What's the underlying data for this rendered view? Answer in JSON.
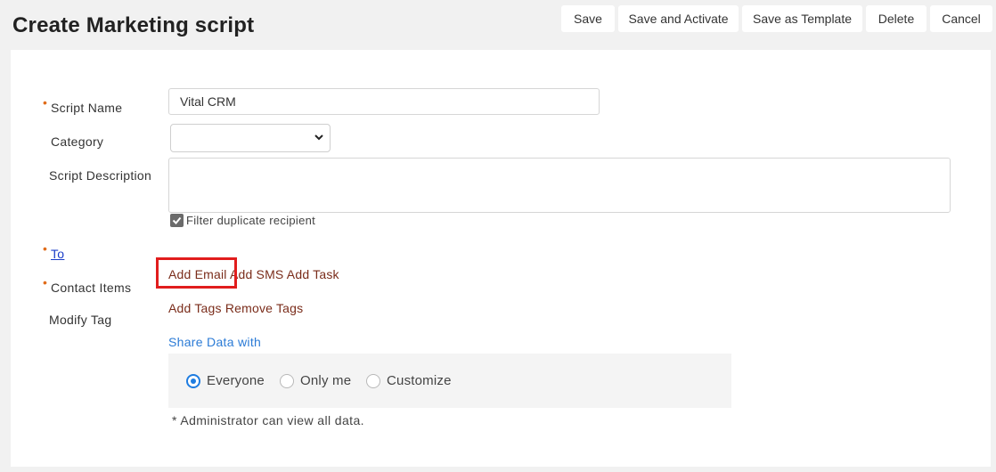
{
  "header": {
    "title": "Create Marketing script"
  },
  "toolbar": {
    "save": "Save",
    "save_activate": "Save and Activate",
    "save_template": "Save as Template",
    "delete": "Delete",
    "cancel": "Cancel"
  },
  "form": {
    "script_name_label": "Script Name",
    "script_name_value": "Vital CRM",
    "category_label": "Category",
    "category_value": "",
    "description_label": "Script Description",
    "description_value": "",
    "filter_duplicate_label": "Filter duplicate recipient",
    "filter_duplicate_checked": true,
    "to_label": "To",
    "contact_items_label": "Contact Items",
    "add_email": "Add Email",
    "add_sms": "Add SMS",
    "add_task": "Add Task",
    "modify_tag_label": "Modify Tag",
    "add_tags": "Add Tags",
    "remove_tags": "Remove Tags"
  },
  "share": {
    "link": "Share Data with",
    "options": [
      "Everyone",
      "Only me",
      "Customize"
    ],
    "selected": "Everyone",
    "note": "*  Administrator can view all data."
  },
  "colors": {
    "required_marker": "#e06c1a",
    "action_link": "#7a2c1a",
    "share_link": "#2b7bd6",
    "radio_selected": "#1e7ce0",
    "highlight_box": "#e11d1d"
  }
}
